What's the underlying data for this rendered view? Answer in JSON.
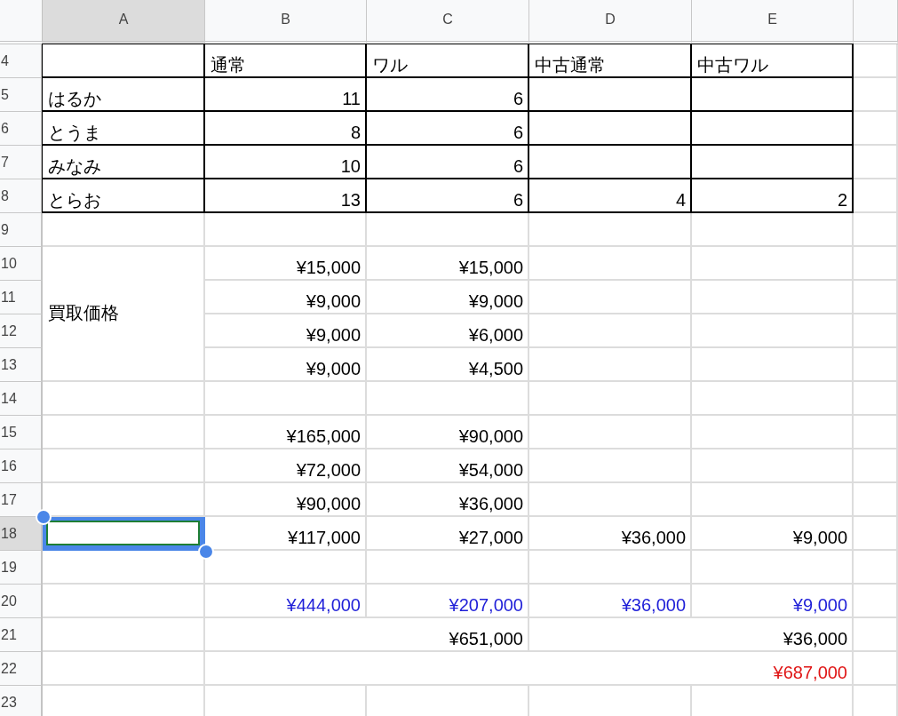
{
  "columns": [
    "A",
    "B",
    "C",
    "D",
    "E"
  ],
  "rows": [
    {
      "number": "4",
      "bordered": true,
      "cells": [
        {
          "kind": "empty",
          "selected": false
        },
        {
          "kind": "text",
          "text": "通常",
          "selected": false
        },
        {
          "kind": "text",
          "text": "ワル",
          "selected": false
        },
        {
          "kind": "text",
          "text": "中古通常",
          "selected": false
        },
        {
          "kind": "text",
          "text": "中古ワル",
          "selected": false
        }
      ]
    },
    {
      "number": "5",
      "bordered": true,
      "cells": [
        {
          "kind": "text",
          "text": "はるか",
          "selected": false
        },
        {
          "kind": "number",
          "text": "11",
          "selected": false
        },
        {
          "kind": "number",
          "text": "6",
          "selected": false
        },
        {
          "kind": "empty",
          "selected": false
        },
        {
          "kind": "empty",
          "selected": false
        }
      ]
    },
    {
      "number": "6",
      "bordered": true,
      "cells": [
        {
          "kind": "text",
          "text": "とうま",
          "selected": false
        },
        {
          "kind": "number",
          "text": "8",
          "selected": false
        },
        {
          "kind": "number",
          "text": "6",
          "selected": false
        },
        {
          "kind": "empty",
          "selected": false
        },
        {
          "kind": "empty",
          "selected": false
        }
      ]
    },
    {
      "number": "7",
      "bordered": true,
      "cells": [
        {
          "kind": "text",
          "text": "みなみ",
          "selected": false
        },
        {
          "kind": "number",
          "text": "10",
          "selected": false
        },
        {
          "kind": "number",
          "text": "6",
          "selected": false
        },
        {
          "kind": "empty",
          "selected": false
        },
        {
          "kind": "empty",
          "selected": false
        }
      ]
    },
    {
      "number": "8",
      "bordered": true,
      "cells": [
        {
          "kind": "text",
          "text": "とらお",
          "selected": false
        },
        {
          "kind": "number",
          "text": "13",
          "selected": false
        },
        {
          "kind": "number",
          "text": "6",
          "selected": false
        },
        {
          "kind": "number",
          "text": "4",
          "selected": false
        },
        {
          "kind": "number",
          "text": "2",
          "selected": false
        }
      ]
    },
    {
      "number": "9",
      "bordered": false,
      "cells": [
        {
          "kind": "empty",
          "selected": false
        },
        {
          "kind": "empty",
          "selected": false
        },
        {
          "kind": "empty",
          "selected": false
        },
        {
          "kind": "empty",
          "selected": false
        },
        {
          "kind": "empty",
          "selected": false
        }
      ]
    },
    {
      "number": "10",
      "bordered": false,
      "cells": [
        {
          "kind": "text",
          "text": "買取価格",
          "selected": false
        },
        {
          "kind": "number",
          "text": "¥15,000",
          "selected": false
        },
        {
          "kind": "number",
          "text": "¥15,000",
          "selected": false
        },
        {
          "kind": "empty",
          "selected": false
        },
        {
          "kind": "empty",
          "selected": false
        }
      ]
    },
    {
      "number": "11",
      "bordered": false,
      "cells": [
        {
          "kind": "merged-up"
        },
        {
          "kind": "number",
          "text": "¥9,000",
          "selected": false
        },
        {
          "kind": "number",
          "text": "¥9,000",
          "selected": false
        },
        {
          "kind": "empty",
          "selected": false
        },
        {
          "kind": "empty",
          "selected": false
        }
      ]
    },
    {
      "number": "12",
      "bordered": false,
      "cells": [
        {
          "kind": "merged-up"
        },
        {
          "kind": "number",
          "text": "¥9,000",
          "selected": false
        },
        {
          "kind": "number",
          "text": "¥6,000",
          "selected": false
        },
        {
          "kind": "empty",
          "selected": false
        },
        {
          "kind": "empty",
          "selected": false
        }
      ]
    },
    {
      "number": "13",
      "bordered": false,
      "cells": [
        {
          "kind": "merged-up"
        },
        {
          "kind": "number",
          "text": "¥9,000",
          "selected": false
        },
        {
          "kind": "number",
          "text": "¥4,500",
          "selected": false
        },
        {
          "kind": "empty",
          "selected": false
        },
        {
          "kind": "empty",
          "selected": false
        }
      ]
    },
    {
      "number": "14",
      "bordered": false,
      "cells": [
        {
          "kind": "empty",
          "selected": false
        },
        {
          "kind": "empty",
          "selected": false
        },
        {
          "kind": "empty",
          "selected": false
        },
        {
          "kind": "empty",
          "selected": false
        },
        {
          "kind": "empty",
          "selected": false
        }
      ]
    },
    {
      "number": "15",
      "bordered": false,
      "cells": [
        {
          "kind": "empty",
          "selected": false
        },
        {
          "kind": "number",
          "text": "¥165,000",
          "selected": false
        },
        {
          "kind": "number",
          "text": "¥90,000",
          "selected": false
        },
        {
          "kind": "empty",
          "selected": false
        },
        {
          "kind": "empty",
          "selected": false
        }
      ]
    },
    {
      "number": "16",
      "bordered": false,
      "cells": [
        {
          "kind": "empty",
          "selected": false
        },
        {
          "kind": "number",
          "text": "¥72,000",
          "selected": false
        },
        {
          "kind": "number",
          "text": "¥54,000",
          "selected": false
        },
        {
          "kind": "empty",
          "selected": false
        },
        {
          "kind": "empty",
          "selected": false
        }
      ]
    },
    {
      "number": "17",
      "bordered": false,
      "cells": [
        {
          "kind": "empty",
          "selected": false
        },
        {
          "kind": "number",
          "text": "¥90,000",
          "selected": false
        },
        {
          "kind": "number",
          "text": "¥36,000",
          "selected": false
        },
        {
          "kind": "empty",
          "selected": false
        },
        {
          "kind": "empty",
          "selected": false
        }
      ]
    },
    {
      "number": "18",
      "bordered": false,
      "cells": [
        {
          "kind": "empty",
          "selected": true
        },
        {
          "kind": "number",
          "text": "¥117,000",
          "selected": false
        },
        {
          "kind": "number",
          "text": "¥27,000",
          "selected": false
        },
        {
          "kind": "number",
          "text": "¥36,000",
          "selected": false
        },
        {
          "kind": "number",
          "text": "¥9,000",
          "selected": false
        }
      ]
    },
    {
      "number": "19",
      "bordered": false,
      "cells": [
        {
          "kind": "empty",
          "selected": false
        },
        {
          "kind": "empty",
          "selected": false
        },
        {
          "kind": "empty",
          "selected": false
        },
        {
          "kind": "empty",
          "selected": false
        },
        {
          "kind": "empty",
          "selected": false
        }
      ]
    },
    {
      "number": "20",
      "bordered": false,
      "cells": [
        {
          "kind": "empty",
          "selected": false
        },
        {
          "kind": "number",
          "text": "¥444,000",
          "color": "#1f1fd8",
          "selected": false
        },
        {
          "kind": "number",
          "text": "¥207,000",
          "color": "#1f1fd8",
          "selected": false
        },
        {
          "kind": "number",
          "text": "¥36,000",
          "color": "#1f1fd8",
          "selected": false
        },
        {
          "kind": "number",
          "text": "¥9,000",
          "color": "#1f1fd8",
          "selected": false
        }
      ]
    },
    {
      "number": "21",
      "bordered": false,
      "cells": [
        {
          "kind": "empty",
          "selected": false
        },
        {
          "kind": "number",
          "text": "¥651,000",
          "selected": false
        },
        {
          "kind": "merged-left"
        },
        {
          "kind": "number",
          "text": "¥36,000",
          "selected": false
        },
        {
          "kind": "merged-left"
        }
      ]
    },
    {
      "number": "22",
      "bordered": false,
      "cells": [
        {
          "kind": "empty",
          "selected": false
        },
        {
          "kind": "number",
          "text": "¥687,000",
          "color": "#e01515",
          "selected": false
        },
        {
          "kind": "merged-left"
        },
        {
          "kind": "merged-left"
        },
        {
          "kind": "merged-left"
        }
      ]
    },
    {
      "number": "23",
      "bordered": false,
      "cells": [
        {
          "kind": "empty",
          "selected": false
        },
        {
          "kind": "empty",
          "selected": false
        },
        {
          "kind": "empty",
          "selected": false
        },
        {
          "kind": "empty",
          "selected": false
        },
        {
          "kind": "empty",
          "selected": false
        }
      ]
    }
  ]
}
